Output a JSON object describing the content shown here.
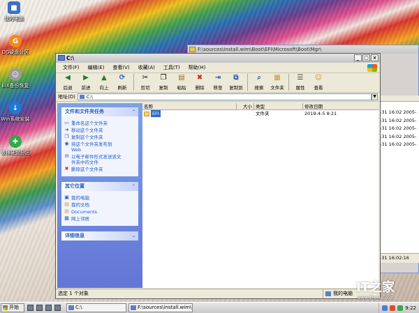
{
  "desktop": {
    "icons": [
      {
        "label": "我的电脑",
        "icon": "computer-icon",
        "color": "#3a6fc4"
      },
      {
        "label": "DG硬盘分区",
        "icon": "diskgenius-icon",
        "color": "#f08a1c"
      },
      {
        "label": "EIX备份恢复",
        "icon": "backup-icon",
        "color": "#888888"
      },
      {
        "label": "Win系统安装",
        "icon": "install-icon",
        "color": "#1f7ad6"
      },
      {
        "label": "傲梅硬盘分区",
        "icon": "partition-icon",
        "color": "#2fa84a"
      }
    ]
  },
  "back_window": {
    "title": "F:\\sources\\install.wim\\Boot\\EFI\\Microsoft\\Boot\\Mgr\\",
    "rows": [
      "-31 16:02  2005-",
      "-31 16:02  2005-",
      "-31 16:02  2005-",
      "-31 16:02  2005-",
      "-31 16:02  2005-"
    ],
    "bottom_time": "-31 16:02:16"
  },
  "window": {
    "title": "C:\\",
    "menu": [
      "文件(F)",
      "编辑(E)",
      "查看(V)",
      "收藏(A)",
      "工具(T)",
      "帮助(H)"
    ],
    "toolbar": {
      "back": "后退",
      "forward": "前进",
      "up": "向上",
      "refresh": "刷新",
      "cut": "剪切",
      "copy": "复制",
      "paste": "粘贴",
      "delete": "删除",
      "move_to": "移至",
      "copy_to": "复制到",
      "search": "搜索",
      "folders": "文件夹",
      "properties": "属性",
      "views": "查看"
    },
    "address": {
      "label": "地址(D)",
      "value": "C:\\"
    },
    "tasks_panel": {
      "title": "文件和文件夹任务",
      "items": [
        {
          "lines": [
            "重命名这个文件夹"
          ]
        },
        {
          "lines": [
            "移动这个文件夹"
          ]
        },
        {
          "lines": [
            "复制这个文件夹"
          ]
        },
        {
          "lines": [
            "将这个文件夹发布到",
            "Web"
          ]
        },
        {
          "lines": [
            "以电子邮件形式发送该文",
            "件夹中的文件"
          ]
        },
        {
          "lines": [
            "删除这个文件夹"
          ]
        }
      ]
    },
    "places_panel": {
      "title": "其它位置",
      "items": [
        "我的电脑",
        "我的文档",
        "Documents",
        "网上邻居"
      ]
    },
    "details_panel": {
      "title": "详细信息"
    },
    "columns": {
      "name": "名称",
      "size": "大小",
      "type": "类型",
      "modified": "修改日期"
    },
    "files": [
      {
        "name": "EFI",
        "size": "",
        "type": "文件夹",
        "modified": "2019-4-5 8:21"
      }
    ],
    "status": {
      "left": "选定 1 个对象",
      "right": "我的电脑"
    }
  },
  "watermark": {
    "logo": "IT之家",
    "url": "www.ithome.com"
  },
  "taskbar": {
    "start": "开始",
    "tasks": [
      "C:\\",
      "F:\\sources\\install.wim\\Bo..."
    ],
    "clock": "9:22"
  }
}
